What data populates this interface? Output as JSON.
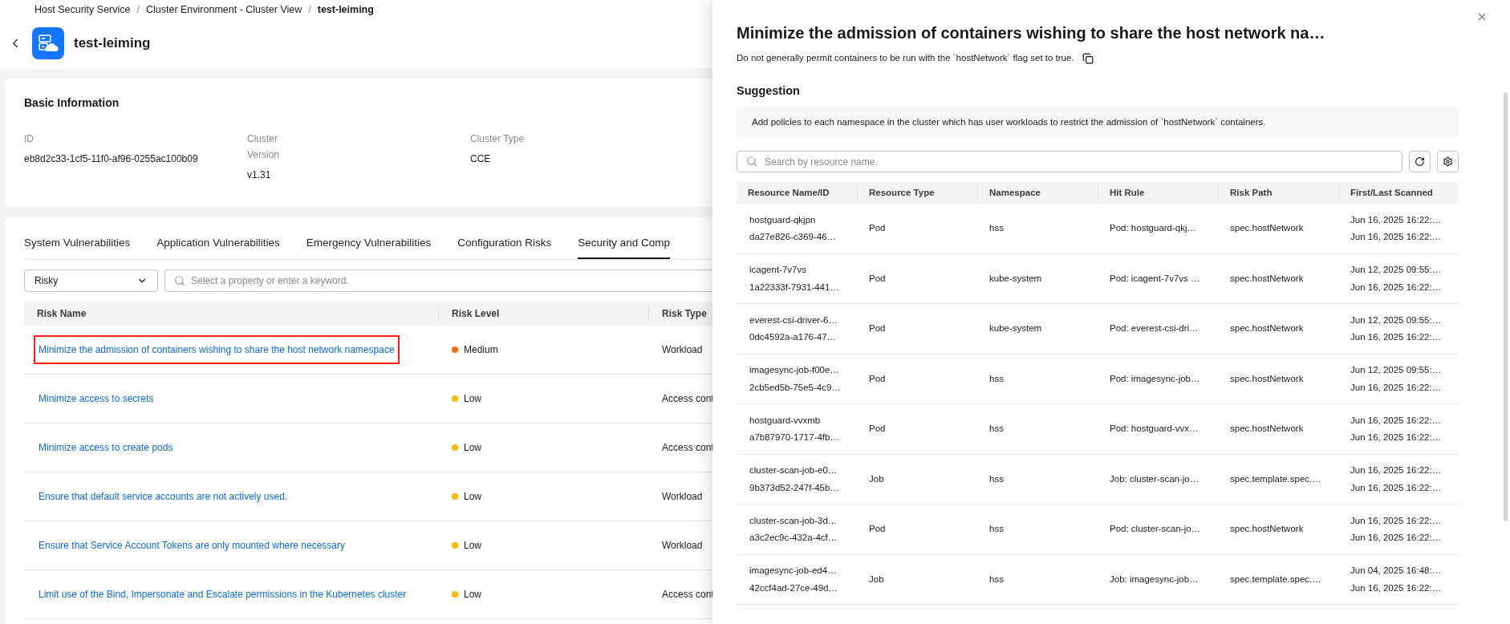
{
  "breadcrumb": {
    "separator": "/",
    "items": [
      {
        "label": "Host Security Service"
      },
      {
        "label": "Cluster Environment - Cluster View"
      },
      {
        "label": "test-leiming"
      }
    ]
  },
  "header": {
    "title": "test-leiming"
  },
  "basic_info": {
    "title": "Basic Information",
    "fields": [
      {
        "label": "ID",
        "value": "eb8d2c33-1cf5-11f0-af96-0255ac100b09"
      },
      {
        "label": "Cluster Version",
        "value": "v1.31"
      },
      {
        "label": "Cluster Type",
        "value": "CCE"
      }
    ]
  },
  "tabs": [
    {
      "label": "System Vulnerabilities",
      "selected": false
    },
    {
      "label": "Application Vulnerabilities",
      "selected": false
    },
    {
      "label": "Emergency Vulnerabilities",
      "selected": false
    },
    {
      "label": "Configuration Risks",
      "selected": false
    },
    {
      "label": "Security and Comp",
      "selected": true
    }
  ],
  "filter": {
    "value": "Risky"
  },
  "search": {
    "placeholder": "Select a property or enter a keyword."
  },
  "risk_table": {
    "columns": [
      "Risk Name",
      "Risk Level",
      "Risk Type"
    ],
    "rows": [
      {
        "name": "Minimize the admission of containers wishing to share the host network namespace",
        "level": "Medium",
        "color": "#f66f00",
        "type": "Workload",
        "highlighted": true
      },
      {
        "name": "Minimize access to secrets",
        "level": "Low",
        "color": "#ffb800",
        "type": "Access cont",
        "highlighted": false
      },
      {
        "name": "Minimize access to create pods",
        "level": "Low",
        "color": "#ffb800",
        "type": "Access cont",
        "highlighted": false
      },
      {
        "name": "Ensure that default service accounts are not actively used.",
        "level": "Low",
        "color": "#ffb800",
        "type": "Workload",
        "highlighted": false
      },
      {
        "name": "Ensure that Service Account Tokens are only mounted where necessary",
        "level": "Low",
        "color": "#ffb800",
        "type": "Workload",
        "highlighted": false
      },
      {
        "name": "Limit use of the Bind, Impersonate and Escalate permissions in the Kubernetes cluster",
        "level": "Low",
        "color": "#ffb800",
        "type": "Access cont",
        "highlighted": false
      }
    ]
  },
  "drawer": {
    "title": "Minimize the admission of containers wishing to share the host network na…",
    "description": "Do not generally permit containers to be run with the `hostNetwork` flag set to true.",
    "suggestion_title": "Suggestion",
    "suggestion": "Add policies to each namespace in the cluster which has user workloads to restrict the admission of `hostNetwork` containers.",
    "search": {
      "placeholder": "Search by resource name."
    },
    "table": {
      "columns": [
        "Resource Name/ID",
        "Resource Type",
        "Namespace",
        "Hit Rule",
        "Risk Path",
        "First/Last Scanned"
      ],
      "rows": [
        {
          "name": "hostguard-qkjpn",
          "id": "da27e826-c369-46…",
          "type": "Pod",
          "namespace": "hss",
          "hit_rule": "Pod: hostguard-qkj…",
          "risk_path": "spec.hostNetwork",
          "first_scanned": "Jun 16, 2025 16:22:…",
          "last_scanned": "Jun 16, 2025 16:22:…"
        },
        {
          "name": "icagent-7v7vs",
          "id": "1a22333f-7931-441…",
          "type": "Pod",
          "namespace": "kube-system",
          "hit_rule": "Pod: icagent-7v7vs …",
          "risk_path": "spec.hostNetwork",
          "first_scanned": "Jun 12, 2025 09:55:…",
          "last_scanned": "Jun 16, 2025 16:22:…"
        },
        {
          "name": "everest-csi-driver-6…",
          "id": "0dc4592a-a176-47…",
          "type": "Pod",
          "namespace": "kube-system",
          "hit_rule": "Pod: everest-csi-dri…",
          "risk_path": "spec.hostNetwork",
          "first_scanned": "Jun 12, 2025 09:55:…",
          "last_scanned": "Jun 16, 2025 16:22:…"
        },
        {
          "name": "imagesync-job-f00e…",
          "id": "2cb5ed5b-75e5-4c9…",
          "type": "Pod",
          "namespace": "hss",
          "hit_rule": "Pod: imagesync-job…",
          "risk_path": "spec.hostNetwork",
          "first_scanned": "Jun 12, 2025 09:55:…",
          "last_scanned": "Jun 16, 2025 16:22:…"
        },
        {
          "name": "hostguard-vvxmb",
          "id": "a7b87970-1717-4fb…",
          "type": "Pod",
          "namespace": "hss",
          "hit_rule": "Pod: hostguard-vvx…",
          "risk_path": "spec.hostNetwork",
          "first_scanned": "Jun 16, 2025 16:22:…",
          "last_scanned": "Jun 16, 2025 16:22:…"
        },
        {
          "name": "cluster-scan-job-e0…",
          "id": "9b373d52-247f-45b…",
          "type": "Job",
          "namespace": "hss",
          "hit_rule": "Job: cluster-scan-jo…",
          "risk_path": "spec.template.spec.…",
          "first_scanned": "Jun 16, 2025 16:22:…",
          "last_scanned": "Jun 16, 2025 16:22:…"
        },
        {
          "name": "cluster-scan-job-3d…",
          "id": "a3c2ec9c-432a-4cf…",
          "type": "Pod",
          "namespace": "hss",
          "hit_rule": "Pod: cluster-scan-jo…",
          "risk_path": "spec.hostNetwork",
          "first_scanned": "Jun 16, 2025 16:22:…",
          "last_scanned": "Jun 16, 2025 16:22:…"
        },
        {
          "name": "imagesync-job-ed4…",
          "id": "42ccf4ad-27ce-49d…",
          "type": "Job",
          "namespace": "hss",
          "hit_rule": "Job: imagesync-job…",
          "risk_path": "spec.template.spec.…",
          "first_scanned": "Jun 04, 2025 16:48:…",
          "last_scanned": "Jun 16, 2025 16:22:…"
        }
      ]
    }
  }
}
